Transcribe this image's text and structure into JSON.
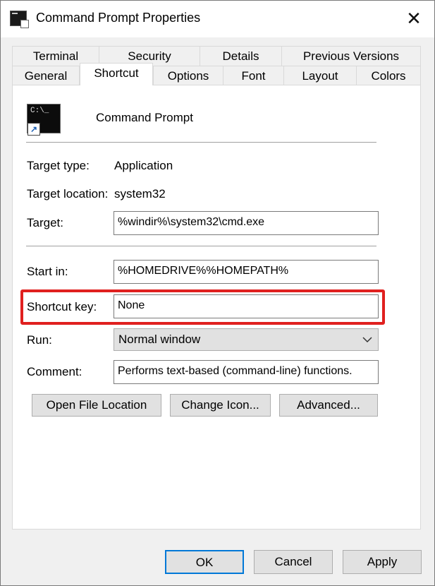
{
  "window": {
    "title": "Command Prompt Properties",
    "close_glyph": "✕"
  },
  "tabs": {
    "row1": [
      "Terminal",
      "Security",
      "Details",
      "Previous Versions"
    ],
    "row2": [
      "General",
      "Shortcut",
      "Options",
      "Font",
      "Layout",
      "Colors"
    ],
    "active": "Shortcut"
  },
  "shortcut": {
    "app_name": "Command Prompt",
    "icon_text": "C:\\_",
    "icon_name": "cmd-icon",
    "target_type_label": "Target type:",
    "target_type_value": "Application",
    "target_location_label": "Target location:",
    "target_location_value": "system32",
    "target_label": "Target:",
    "target_value": "%windir%\\system32\\cmd.exe",
    "start_in_label": "Start in:",
    "start_in_value": "%HOMEDRIVE%%HOMEPATH%",
    "shortcut_key_label": "Shortcut key:",
    "shortcut_key_value": "None",
    "run_label": "Run:",
    "run_value": "Normal window",
    "comment_label": "Comment:",
    "comment_value": "Performs text-based (command-line) functions.",
    "open_file_location": "Open File Location",
    "change_icon": "Change Icon...",
    "advanced": "Advanced..."
  },
  "footer": {
    "ok": "OK",
    "cancel": "Cancel",
    "apply": "Apply"
  },
  "colors": {
    "highlight": "#e0201f",
    "default_button_border": "#0078d7"
  }
}
